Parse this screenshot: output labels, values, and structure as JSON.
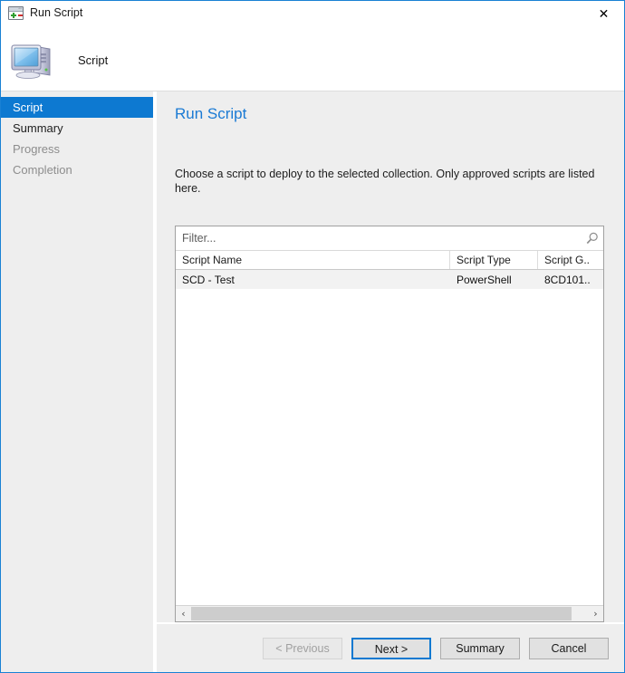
{
  "window": {
    "title": "Run Script",
    "title_icon": "script-window-icon",
    "close_icon": "✕",
    "accent_color": "#0d79d1",
    "border_color": "#1981d4"
  },
  "banner": {
    "icon": "computer-icon",
    "label": "Script"
  },
  "sidebar": {
    "items": [
      {
        "label": "Script",
        "state": "selected"
      },
      {
        "label": "Summary",
        "state": "enabled"
      },
      {
        "label": "Progress",
        "state": "disabled"
      },
      {
        "label": "Completion",
        "state": "disabled"
      }
    ]
  },
  "main": {
    "title": "Run Script",
    "description": "Choose a script to deploy to the selected collection. Only approved scripts are listed here."
  },
  "filter": {
    "value": "",
    "placeholder": "Filter...",
    "icon": "search-icon"
  },
  "grid": {
    "columns": [
      "Script Name",
      "Script Type",
      "Script G.."
    ],
    "rows": [
      {
        "name": "SCD - Test",
        "type": "PowerShell",
        "guid": "8CD101.."
      }
    ],
    "scrollbar": {
      "left_arrow": "‹",
      "right_arrow": "›"
    }
  },
  "footer": {
    "buttons": [
      {
        "label": "< Previous",
        "state": "disabled"
      },
      {
        "label": "Next >",
        "state": "default"
      },
      {
        "label": "Summary",
        "state": "enabled"
      },
      {
        "label": "Cancel",
        "state": "enabled"
      }
    ]
  }
}
